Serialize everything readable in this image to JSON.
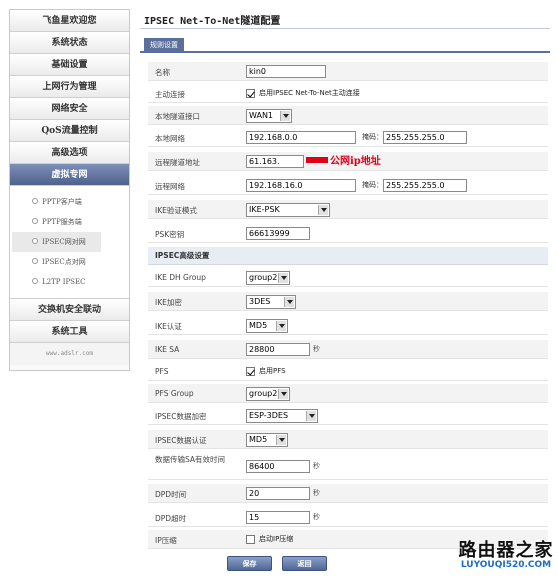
{
  "sidebar": {
    "items_top": [
      "飞鱼星欢迎您",
      "系统状态",
      "基础设置",
      "上网行为管理",
      "网络安全",
      "QoS流量控制",
      "高级选项"
    ],
    "active": "虚拟专网",
    "submenu": [
      "PPTP客户端",
      "PPTP服务端",
      "IPSEC网对网",
      "IPSEC点对网",
      "L2TP IPSEC"
    ],
    "items_bottom": [
      "交换机安全联动",
      "系统工具"
    ],
    "footer": "www.adslr.com"
  },
  "page": {
    "title": "IPSEC Net-To-Net隧道配置",
    "tab": "规则设置"
  },
  "form": {
    "name": {
      "label": "名称",
      "value": "kin0"
    },
    "auto_connect": {
      "label": "主动连接",
      "checked": true,
      "text": "启用IPSEC Net-To-Net主动连接"
    },
    "local_interface": {
      "label": "本地隧道接口",
      "value": "WAN1"
    },
    "local_net": {
      "label": "本地网络",
      "ip": "192.168.0.0",
      "mask_label": "掩码：",
      "mask": "255.255.255.0"
    },
    "remote_addr": {
      "label": "远程隧道地址",
      "value": "61.163.",
      "annotation": "公网ip地址"
    },
    "remote_net": {
      "label": "远程网络",
      "ip": "192.168.16.0",
      "mask_label": "掩码：",
      "mask": "255.255.255.0"
    },
    "ike_mode": {
      "label": "IKE验证模式",
      "value": "IKE-PSK"
    },
    "psk": {
      "label": "PSK密钥",
      "value": "66613999"
    },
    "advanced_title": "IPSEC高级设置",
    "ike_dh": {
      "label": "IKE DH Group",
      "value": "group2"
    },
    "ike_enc": {
      "label": "IKE加密",
      "value": "3DES"
    },
    "ike_auth": {
      "label": "IKE认证",
      "value": "MD5"
    },
    "ike_sa": {
      "label": "IKE SA",
      "value": "28800",
      "unit": "秒"
    },
    "pfs": {
      "label": "PFS",
      "checked": true,
      "text": "启用PFS"
    },
    "pfs_group": {
      "label": "PFS Group",
      "value": "group2"
    },
    "ipsec_enc": {
      "label": "IPSEC数据加密",
      "value": "ESP-3DES"
    },
    "ipsec_auth": {
      "label": "IPSEC数据认证",
      "value": "MD5"
    },
    "data_sa": {
      "label": "数据传输SA有效时间",
      "value": "86400",
      "unit": "秒"
    },
    "dpd_time": {
      "label": "DPD时间",
      "value": "20",
      "unit": "秒"
    },
    "dpd_timeout": {
      "label": "DPD超时",
      "value": "15",
      "unit": "秒"
    },
    "ip_compress": {
      "label": "IP压缩",
      "checked": false,
      "text": "启动IP压缩"
    }
  },
  "buttons": {
    "save": "保存",
    "back": "返回"
  },
  "watermark": {
    "cn": "路由器之家",
    "url": "LUYOUQI520.COM"
  }
}
